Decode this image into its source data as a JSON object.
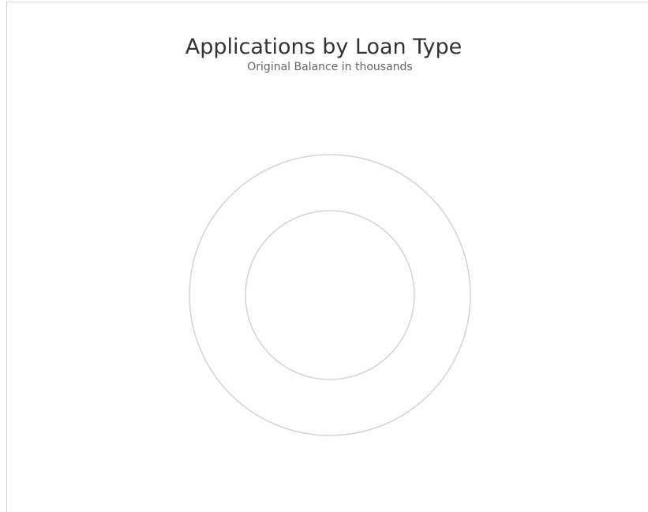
{
  "chart_data": {
    "type": "pie",
    "title": "Applications by Loan Type",
    "subtitle": "Original Balance in thousands",
    "categories": [],
    "values": [],
    "legend": "none",
    "colors": {
      "ring_outline": "#d4d4d4",
      "title": "#333333",
      "subtitle": "#666666"
    }
  }
}
